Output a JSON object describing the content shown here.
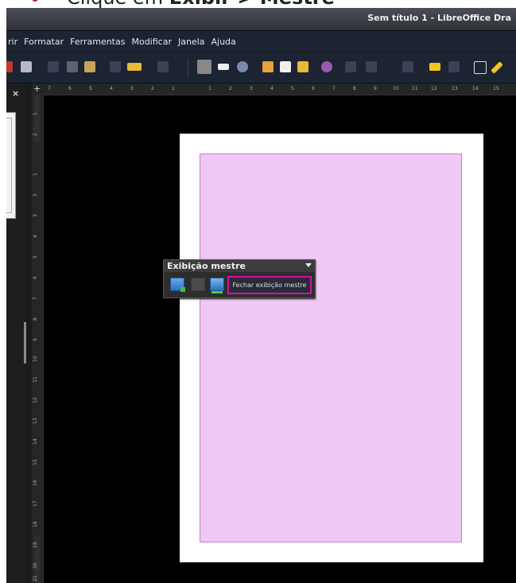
{
  "caption": {
    "prefix": "Clique em ",
    "bold": "Exibir > Mestre"
  },
  "window": {
    "title": "Sem título 1 - LibreOffice Dra"
  },
  "menu": {
    "items": [
      "rir",
      "Formatar",
      "Ferramentas",
      "Modificar",
      "Janela",
      "Ajuda"
    ]
  },
  "sidepanel": {
    "close_glyph": "×"
  },
  "ruler": {
    "origin_glyph": "+",
    "h_ticks": [
      "7",
      "6",
      "5",
      "4",
      "3",
      "2",
      "1",
      "1",
      "2",
      "3",
      "4",
      "5",
      "6",
      "7",
      "8",
      "9",
      "10",
      "11",
      "12",
      "13",
      "14",
      "15"
    ],
    "v_ticks": [
      "1",
      "2",
      "1",
      "2",
      "3",
      "4",
      "5",
      "6",
      "7",
      "8",
      "9",
      "10",
      "11",
      "12",
      "13",
      "14",
      "15",
      "16",
      "17",
      "18",
      "19",
      "20",
      "21"
    ]
  },
  "master_toolbar": {
    "title": "Exibição mestre",
    "close_label": "Fechar exibição mestre"
  },
  "colors": {
    "page_margin_fill": "#f0c8f4",
    "highlight_border": "#d4119e"
  }
}
